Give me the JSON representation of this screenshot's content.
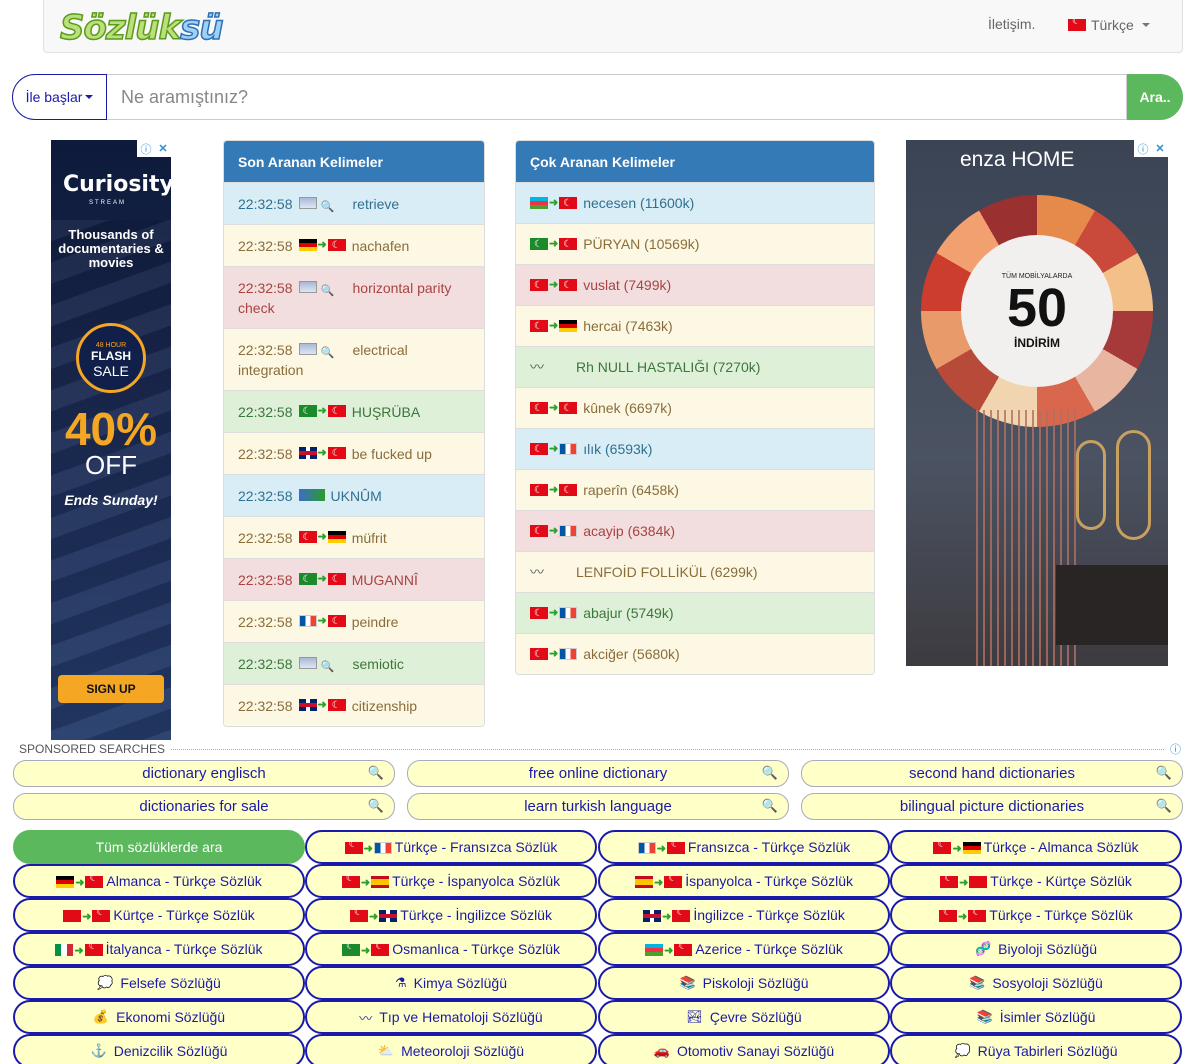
{
  "header": {
    "logo_part1": "Sözlük",
    "logo_part2": "sü",
    "contact": "İletişim.",
    "language": "Türkçe"
  },
  "search": {
    "mode": "İle başlar",
    "placeholder": "Ne aramıştınız?",
    "button": "Ara.."
  },
  "ad_left": {
    "brand": "Curiosity",
    "brand_sub": "STREAM",
    "tagline": "Thousands of documentaries & movies",
    "badge_top": "48 HOUR",
    "badge_mid": "FLASH",
    "badge_bot": "SALE",
    "percent": "40%",
    "off": "OFF",
    "ends": "Ends Sunday!",
    "cta": "SIGN UP"
  },
  "ad_right": {
    "brand": "enza HOME",
    "small": "TÜM MOBİLYALARDA",
    "big": "50",
    "bottom": "İNDİRİM"
  },
  "recent": {
    "title": "Son Aranan Kelimeler",
    "rows": [
      {
        "time": "22:32:58",
        "text": "retrieve",
        "style": "info",
        "f": [
          "pc"
        ]
      },
      {
        "time": "22:32:58",
        "text": "nachafen",
        "style": "warn",
        "f": [
          "de",
          "tr"
        ]
      },
      {
        "time": "22:32:58",
        "text": "horizontal parity check",
        "style": "danger",
        "f": [
          "pc"
        ]
      },
      {
        "time": "22:32:58",
        "text": "electrical integration",
        "style": "warn",
        "f": [
          "pc"
        ]
      },
      {
        "time": "22:32:58",
        "text": "HUŞRÜBA",
        "style": "success",
        "f": [
          "os",
          "tr"
        ]
      },
      {
        "time": "22:32:58",
        "text": "be fucked up",
        "style": "warn",
        "f": [
          "gb",
          "tr"
        ]
      },
      {
        "time": "22:32:58",
        "text": "UKNÛM",
        "style": "info",
        "f": [
          "ar"
        ]
      },
      {
        "time": "22:32:58",
        "text": "müfrit",
        "style": "warn",
        "f": [
          "tr",
          "de"
        ]
      },
      {
        "time": "22:32:58",
        "text": "MUGANNÎ",
        "style": "danger",
        "f": [
          "os",
          "tr"
        ]
      },
      {
        "time": "22:32:58",
        "text": "peindre",
        "style": "warn",
        "f": [
          "fr",
          "tr"
        ]
      },
      {
        "time": "22:32:58",
        "text": "semiotic",
        "style": "success",
        "f": [
          "pc"
        ]
      },
      {
        "time": "22:32:58",
        "text": "citizenship",
        "style": "warn",
        "f": [
          "gb",
          "tr"
        ]
      }
    ]
  },
  "popular": {
    "title": "Çok Aranan Kelimeler",
    "rows": [
      {
        "text": "necesen (11600k)",
        "style": "info",
        "f": [
          "az",
          "tr"
        ]
      },
      {
        "text": "PÜRYAN (10569k)",
        "style": "warn",
        "f": [
          "os",
          "tr"
        ]
      },
      {
        "text": "vuslat (7499k)",
        "style": "danger",
        "f": [
          "tr",
          "tr"
        ]
      },
      {
        "text": "hercai (7463k)",
        "style": "warn",
        "f": [
          "tr",
          "de"
        ]
      },
      {
        "text": "Rh NULL HASTALIĞI (7270k)",
        "style": "success",
        "f": [
          "curve"
        ]
      },
      {
        "text": "kûnek (6697k)",
        "style": "warn",
        "f": [
          "tr",
          "tr"
        ]
      },
      {
        "text": "ılık (6593k)",
        "style": "info",
        "f": [
          "tr",
          "fr"
        ]
      },
      {
        "text": "raperîn (6458k)",
        "style": "warn",
        "f": [
          "tr",
          "tr"
        ]
      },
      {
        "text": "acayip (6384k)",
        "style": "danger",
        "f": [
          "tr",
          "fr"
        ]
      },
      {
        "text": "LENFOİD FOLLİKÜL (6299k)",
        "style": "warn",
        "f": [
          "curve"
        ]
      },
      {
        "text": "abajur (5749k)",
        "style": "success",
        "f": [
          "tr",
          "fr"
        ]
      },
      {
        "text": "akciğer (5680k)",
        "style": "warn",
        "f": [
          "tr",
          "fr"
        ]
      }
    ]
  },
  "sponsored": {
    "label": "SPONSORED SEARCHES",
    "items": [
      "dictionary englisch",
      "free online dictionary",
      "second hand dictionaries",
      "dictionaries for sale",
      "learn turkish language",
      "bilingual picture dictionaries"
    ]
  },
  "dictionaries": [
    {
      "label": "Tüm sözlüklerde ara",
      "primary": true,
      "f": []
    },
    {
      "label": "Türkçe - Fransızca Sözlük",
      "f": [
        "tr",
        "fr"
      ]
    },
    {
      "label": "Fransızca - Türkçe Sözlük",
      "f": [
        "fr",
        "tr"
      ]
    },
    {
      "label": "Türkçe - Almanca Sözlük",
      "f": [
        "tr",
        "de"
      ]
    },
    {
      "label": "Almanca - Türkçe Sözlük",
      "f": [
        "de",
        "tr"
      ]
    },
    {
      "label": "Türkçe - İspanyolca Sözlük",
      "f": [
        "tr",
        "es"
      ]
    },
    {
      "label": "İspanyolca - Türkçe Sözlük",
      "f": [
        "es",
        "tr"
      ]
    },
    {
      "label": "Türkçe - Kürtçe Sözlük",
      "f": [
        "tr",
        "ku"
      ]
    },
    {
      "label": "Kürtçe - Türkçe Sözlük",
      "f": [
        "ku",
        "tr"
      ]
    },
    {
      "label": "Türkçe - İngilizce Sözlük",
      "f": [
        "tr",
        "gb"
      ]
    },
    {
      "label": "İngilizce - Türkçe Sözlük",
      "f": [
        "gb",
        "tr"
      ]
    },
    {
      "label": "Türkçe - Türkçe Sözlük",
      "f": [
        "tr",
        "tr"
      ]
    },
    {
      "label": "İtalyanca - Türkçe Sözlük",
      "f": [
        "it",
        "tr"
      ]
    },
    {
      "label": "Osmanlıca - Türkçe Sözlük",
      "f": [
        "os",
        "tr"
      ]
    },
    {
      "label": "Azerice - Türkçe Sözlük",
      "f": [
        "az",
        "tr"
      ]
    },
    {
      "label": "Biyoloji Sözlüğü",
      "icon": "dna-icon"
    },
    {
      "label": "Felsefe Sözlüğü",
      "icon": "thinker-icon"
    },
    {
      "label": "Kimya Sözlüğü",
      "icon": "flask-icon"
    },
    {
      "label": "Piskoloji Sözlüğü",
      "icon": "books-icon"
    },
    {
      "label": "Sosyoloji Sözlüğü",
      "icon": "books-icon"
    },
    {
      "label": "Ekonomi Sözlüğü",
      "icon": "money-icon"
    },
    {
      "label": "Tıp ve Hematoloji Sözlüğü",
      "icon": "stethoscope-icon"
    },
    {
      "label": "Çevre Sözlüğü",
      "icon": "landscape-icon"
    },
    {
      "label": "İsimler Sözlüğü",
      "icon": "books-icon"
    },
    {
      "label": "Denizcilik Sözlüğü",
      "icon": "anchor-icon"
    },
    {
      "label": "Meteoroloji Sözlüğü",
      "icon": "weather-icon"
    },
    {
      "label": "Otomotiv Sanayi Sözlüğü",
      "icon": "car-icon"
    },
    {
      "label": "Rüya Tabirleri Sözlüğü",
      "icon": "dream-icon"
    }
  ]
}
